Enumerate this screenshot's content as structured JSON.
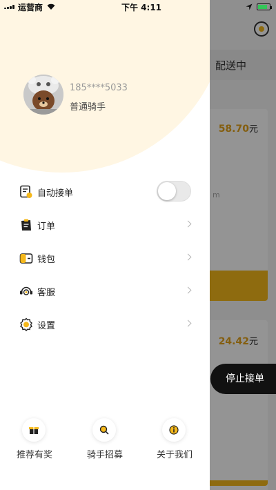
{
  "status_bar": {
    "carrier": "运营商",
    "time": "下午 4:11"
  },
  "background": {
    "tab_label": "配送中",
    "orders": [
      {
        "price": "58.70",
        "unit": "元",
        "distance_hint": "m"
      },
      {
        "price": "24.42",
        "unit": "元"
      }
    ],
    "stop_button": "停止接单"
  },
  "drawer": {
    "user": {
      "phone": "185****5033",
      "role": "普通骑手"
    },
    "auto_accept": {
      "label": "自动接单",
      "enabled": false,
      "icon": "document-icon"
    },
    "menu": [
      {
        "label": "订单",
        "icon": "clipboard-icon"
      },
      {
        "label": "钱包",
        "icon": "wallet-icon"
      },
      {
        "label": "客服",
        "icon": "headset-icon"
      },
      {
        "label": "设置",
        "icon": "gear-icon"
      }
    ],
    "bottom": [
      {
        "label": "推荐有奖",
        "icon": "gift-icon"
      },
      {
        "label": "骑手招募",
        "icon": "search-icon"
      },
      {
        "label": "关于我们",
        "icon": "info-icon"
      }
    ]
  },
  "colors": {
    "accent": "#f5b81b",
    "price": "#e3a21a",
    "drawer_header": "#fff6e3"
  }
}
